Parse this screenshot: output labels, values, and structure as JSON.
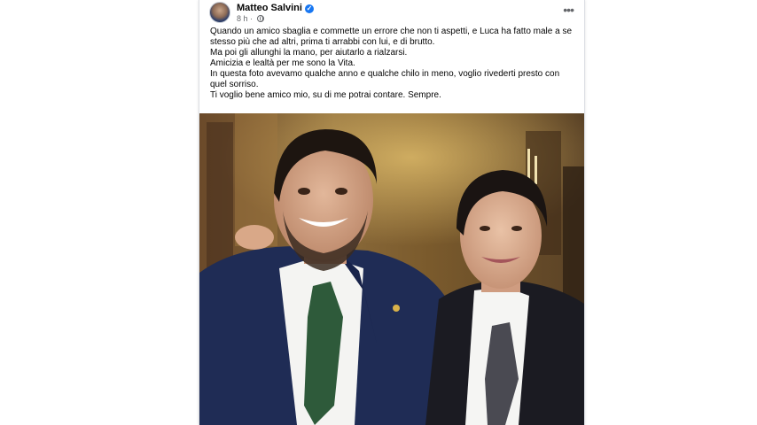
{
  "post": {
    "author": "Matteo Salvini",
    "verified_icon": "check-icon",
    "time": "8 h",
    "audience_icon": "globe-icon",
    "more_icon": "more-options-icon",
    "more_glyph": "•••",
    "check_glyph": "✓",
    "text_lines": [
      "Quando un amico sbaglia e commette un errore che non ti aspetti, e Luca ha fatto male a se stesso più che ad altri, prima ti arrabbi con lui, e di brutto.",
      "Ma poi gli allunghi la mano, per aiutarlo a rialzarsi.",
      "Amicizia e lealtà per me sono la Vita.",
      "In questa foto avevamo qualche anno e qualche chilo in meno, voglio rivederti presto con quel sorriso.",
      "Ti voglio bene amico mio, su di me potrai contare. Sempre."
    ]
  },
  "colors": {
    "accent": "#1877f2",
    "text": "#050505",
    "secondary_text": "#65676b"
  }
}
